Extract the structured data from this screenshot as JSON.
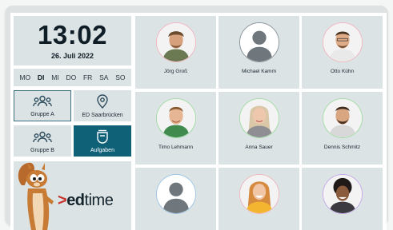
{
  "clock": {
    "time": "13:02",
    "date": "26. Juli 2022"
  },
  "weekdays": [
    {
      "label": "MO",
      "active": false
    },
    {
      "label": "DI",
      "active": true
    },
    {
      "label": "MI",
      "active": false
    },
    {
      "label": "DO",
      "active": false
    },
    {
      "label": "FR",
      "active": false
    },
    {
      "label": "SA",
      "active": false
    },
    {
      "label": "SO",
      "active": false
    }
  ],
  "tiles": {
    "group_a": {
      "label": "Gruppe A",
      "icon": "group-icon",
      "selected": true
    },
    "location": {
      "label": "ED Saarbrücken",
      "icon": "location-pin-icon"
    },
    "group_b": {
      "label": "Gruppe B",
      "icon": "group-icon"
    },
    "tasks": {
      "label": "Aufgaben",
      "icon": "tasks-icon"
    }
  },
  "brand": {
    "logo_chevron": ">",
    "logo_bold": "ed",
    "logo_light": "time",
    "mascot": "squirrel-mascot"
  },
  "people": [
    {
      "name": "Jörg Groß",
      "ring": "#f0b7c1"
    },
    {
      "name": "Michael Kamm",
      "ring": "#8a949b"
    },
    {
      "name": "Otto Kühn",
      "ring": "#f0b7c1"
    },
    {
      "name": "Timo Lehmann",
      "ring": "#a4d9a6"
    },
    {
      "name": "Anna Sauer",
      "ring": "#a4d9a6"
    },
    {
      "name": "Dennis Schmitz",
      "ring": "#a4d9a6"
    },
    {
      "name": "",
      "ring": "#9cc4e6"
    },
    {
      "name": "",
      "ring": "#f0b7c1"
    },
    {
      "name": "",
      "ring": "#c6a8e6"
    }
  ],
  "colors": {
    "panel": "#dbe3e5",
    "accent": "#0f6178",
    "logo_red": "#c9302c"
  }
}
